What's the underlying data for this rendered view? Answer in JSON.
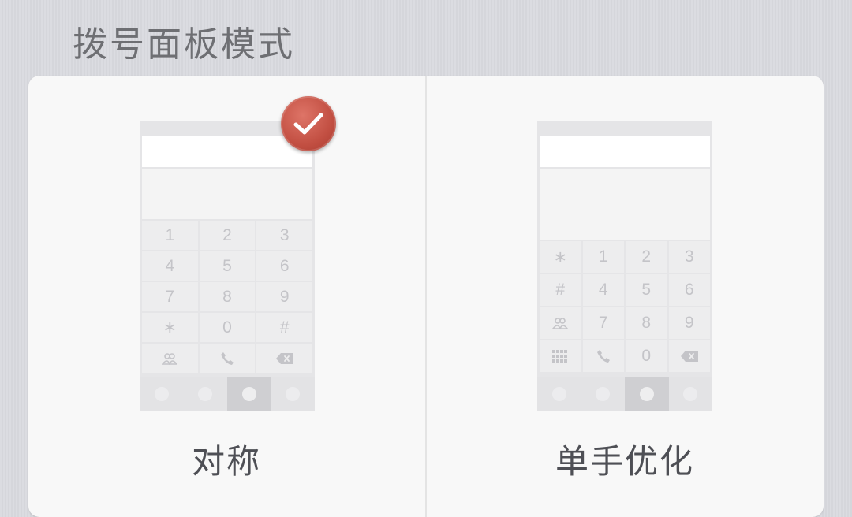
{
  "section_title": "拨号面板模式",
  "colors": {
    "background": "#d9dadf",
    "card": "#f8f8f8",
    "check_badge": "#c55246",
    "key_text": "#c4c4c8"
  },
  "options": [
    {
      "label": "对称",
      "selected": true,
      "keys": [
        {
          "text": "1"
        },
        {
          "text": "2"
        },
        {
          "text": "3"
        },
        {
          "text": "4"
        },
        {
          "text": "5"
        },
        {
          "text": "6"
        },
        {
          "text": "7"
        },
        {
          "text": "8"
        },
        {
          "text": "9"
        },
        {
          "text": "∗"
        },
        {
          "text": "0"
        },
        {
          "text": "#"
        },
        {
          "icon": "contacts-icon"
        },
        {
          "icon": "phone-call-icon"
        },
        {
          "icon": "backspace-icon"
        }
      ],
      "nav_tabs": [
        "dot-1-icon",
        "dot-2-icon",
        "dot-3-icon",
        "dot-4-icon"
      ],
      "active_tab": 2
    },
    {
      "label": "单手优化",
      "selected": false,
      "keys": [
        {
          "text": "∗"
        },
        {
          "text": "1"
        },
        {
          "text": "2"
        },
        {
          "text": "3"
        },
        {
          "text": "#"
        },
        {
          "text": "4"
        },
        {
          "text": "5"
        },
        {
          "text": "6"
        },
        {
          "icon": "contacts-icon"
        },
        {
          "text": "7"
        },
        {
          "text": "8"
        },
        {
          "text": "9"
        },
        {
          "icon": "grid-icon"
        },
        {
          "icon": "phone-call-icon"
        },
        {
          "text": "0"
        },
        {
          "icon": "backspace-icon"
        }
      ],
      "nav_tabs": [
        "dot-1-icon",
        "dot-2-icon",
        "dot-3-icon",
        "dot-4-icon"
      ],
      "active_tab": 2
    }
  ]
}
